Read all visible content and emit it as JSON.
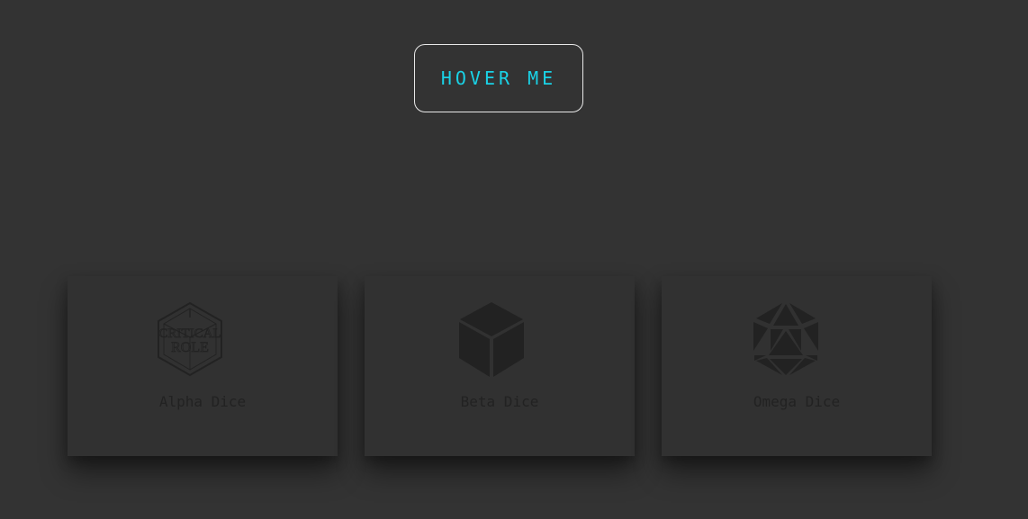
{
  "button": {
    "label": "HOVER ME"
  },
  "cards": [
    {
      "label": "Alpha Dice",
      "icon": "critical-role-logo-icon",
      "logo_text": "CRITICAL ROLE"
    },
    {
      "label": "Beta Dice",
      "icon": "d6-cube-icon"
    },
    {
      "label": "Omega Dice",
      "icon": "d20-icosahedron-icon"
    }
  ],
  "colors": {
    "background": "#333333",
    "button_text": "#1ad2e6",
    "button_border": "#e8e8e8",
    "card_background": "#313131",
    "card_foreground": "#222222"
  }
}
